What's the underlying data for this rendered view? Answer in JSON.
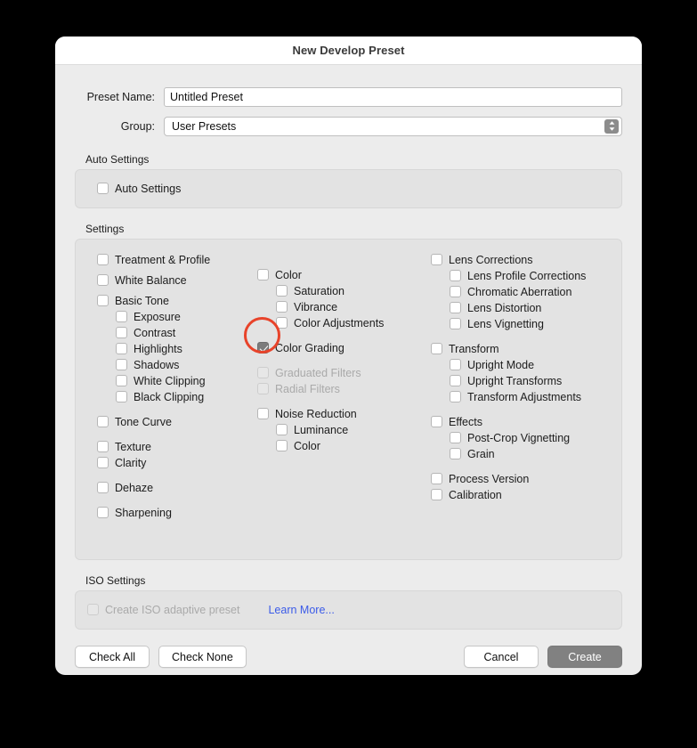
{
  "dialog": {
    "title": "New Develop Preset"
  },
  "form": {
    "preset_name_label": "Preset Name:",
    "preset_name_value": "Untitled Preset",
    "preset_name_placeholder": "Untitled Preset",
    "group_label": "Group:",
    "group_value": "User Presets",
    "group_options": [
      "User Presets"
    ]
  },
  "auto_settings": {
    "title": "Auto Settings",
    "item": {
      "label": "Auto Settings",
      "checked": false,
      "disabled": false
    }
  },
  "settings": {
    "title": "Settings",
    "column1": [
      {
        "label": "Treatment & Profile",
        "checked": false,
        "indent": false
      },
      {
        "label": "White Balance",
        "checked": false,
        "indent": false
      },
      {
        "label": "Basic Tone",
        "checked": false,
        "indent": false
      },
      {
        "label": "Exposure",
        "checked": false,
        "indent": true
      },
      {
        "label": "Contrast",
        "checked": false,
        "indent": true
      },
      {
        "label": "Highlights",
        "checked": false,
        "indent": true
      },
      {
        "label": "Shadows",
        "checked": false,
        "indent": true
      },
      {
        "label": "White Clipping",
        "checked": false,
        "indent": true
      },
      {
        "label": "Black Clipping",
        "checked": false,
        "indent": true
      },
      {
        "label": "Tone Curve",
        "checked": false,
        "indent": false
      },
      {
        "label": "Texture",
        "checked": false,
        "indent": false
      },
      {
        "label": "Clarity",
        "checked": false,
        "indent": false
      },
      {
        "label": "Dehaze",
        "checked": false,
        "indent": false
      },
      {
        "label": "Sharpening",
        "checked": false,
        "indent": false
      }
    ],
    "column2": [
      {
        "label": "Color",
        "checked": false,
        "indent": false,
        "disabled": false
      },
      {
        "label": "Saturation",
        "checked": false,
        "indent": true,
        "disabled": false
      },
      {
        "label": "Vibrance",
        "checked": false,
        "indent": true,
        "disabled": false
      },
      {
        "label": "Color Adjustments",
        "checked": false,
        "indent": true,
        "disabled": false
      },
      {
        "label": "Color Grading",
        "checked": true,
        "indent": false,
        "disabled": false
      },
      {
        "label": "Graduated Filters",
        "checked": false,
        "indent": false,
        "disabled": true
      },
      {
        "label": "Radial Filters",
        "checked": false,
        "indent": false,
        "disabled": true
      },
      {
        "label": "Noise Reduction",
        "checked": false,
        "indent": false,
        "disabled": false
      },
      {
        "label": "Luminance",
        "checked": false,
        "indent": true,
        "disabled": false
      },
      {
        "label": "Color",
        "checked": false,
        "indent": true,
        "disabled": false
      }
    ],
    "column3": [
      {
        "label": "Lens Corrections",
        "checked": false,
        "indent": false
      },
      {
        "label": "Lens Profile Corrections",
        "checked": false,
        "indent": true
      },
      {
        "label": "Chromatic Aberration",
        "checked": false,
        "indent": true
      },
      {
        "label": "Lens Distortion",
        "checked": false,
        "indent": true
      },
      {
        "label": "Lens Vignetting",
        "checked": false,
        "indent": true
      },
      {
        "label": "Transform",
        "checked": false,
        "indent": false
      },
      {
        "label": "Upright Mode",
        "checked": false,
        "indent": true
      },
      {
        "label": "Upright Transforms",
        "checked": false,
        "indent": true
      },
      {
        "label": "Transform Adjustments",
        "checked": false,
        "indent": true
      },
      {
        "label": "Effects",
        "checked": false,
        "indent": false
      },
      {
        "label": "Post-Crop Vignetting",
        "checked": false,
        "indent": true
      },
      {
        "label": "Grain",
        "checked": false,
        "indent": true
      },
      {
        "label": "Process Version",
        "checked": false,
        "indent": false
      },
      {
        "label": "Calibration",
        "checked": false,
        "indent": false
      }
    ]
  },
  "iso_settings": {
    "title": "ISO Settings",
    "checkbox_label": "Create ISO adaptive preset",
    "checkbox_checked": false,
    "checkbox_disabled": true,
    "learn_more": "Learn More..."
  },
  "footer": {
    "check_all": "Check All",
    "check_none": "Check None",
    "cancel": "Cancel",
    "create": "Create"
  },
  "annotation": {
    "target": "Color Grading",
    "color": "#e8432a"
  }
}
